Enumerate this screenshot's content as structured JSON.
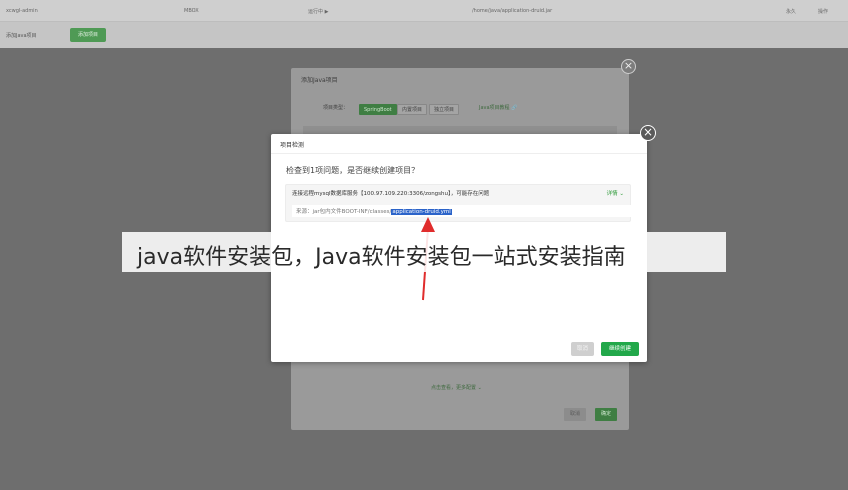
{
  "app": {
    "top": [
      "xcwgl-admin",
      "MBOX",
      "运行中 ▶",
      "/home/java/application-druid.jar",
      "永久",
      "操作"
    ],
    "toolbar_label": "添加Java项目",
    "toolbar_button": "添加项目"
  },
  "back_dialog": {
    "title": "添加Java项目",
    "type_label": "项目类型：",
    "types": [
      "SpringBoot",
      "内置项目",
      "独立项目"
    ],
    "tutorial": "Java项目教程 🔗",
    "more": "点击查看，更多配置 ⌄",
    "cancel": "取消",
    "ok": "确定"
  },
  "dialog": {
    "title": "项目检测",
    "question": "检查到1项问题，是否继续创建项目？",
    "issue_text": "连接远程mysql数据库服务【100.97.109.220:3306/zongshu】，可能存在问题",
    "detail": "详情 ⌄",
    "source_prefix": "来源：jar包内文件BOOT-INF/classes/",
    "source_highlight": "application-druid.yml",
    "cancel": "取消",
    "continue": "继续创建"
  },
  "caption": "java软件安装包，Java软件安装包一站式安装指南",
  "colors": {
    "accent": "#22a84a",
    "highlight": "#2b63c9",
    "arrow": "#e02c2c"
  }
}
